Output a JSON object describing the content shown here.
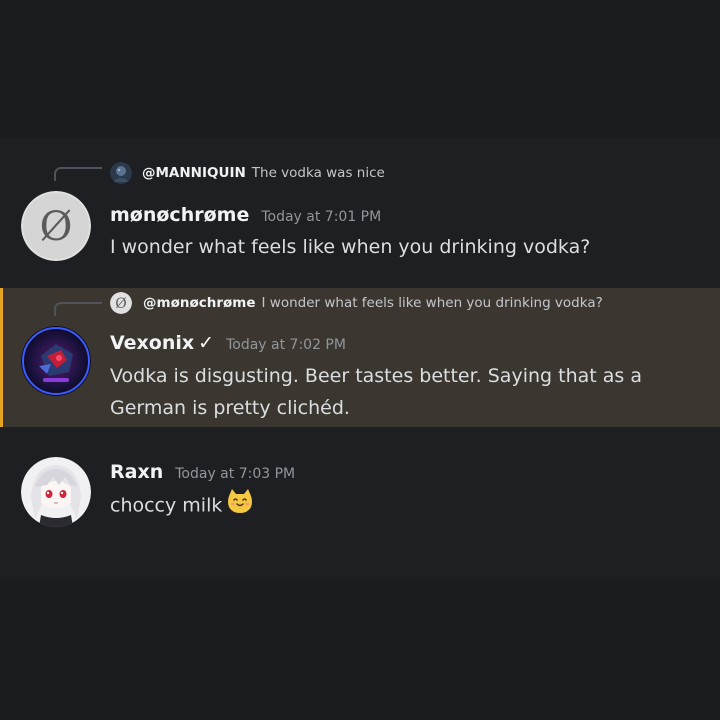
{
  "messages": [
    {
      "reply": {
        "name": "@MANNIQUIN",
        "text": "The vodka was nice",
        "avatar_icon": "manniquin-avatar"
      },
      "author": "mønøchrøme",
      "timestamp": "Today at 7:01 PM",
      "content": "I wonder what feels like when you drinking vodka?",
      "avatar_icon": "null-symbol-avatar",
      "avatar_glyph": "Ø"
    },
    {
      "reply": {
        "name": "@mønøchrøme",
        "text": "I wonder what feels like when you drinking vodka?",
        "avatar_icon": "null-symbol-avatar"
      },
      "author": "Vexonix",
      "verified_mark": "✓",
      "timestamp": "Today at 7:02 PM",
      "content": "Vodka is disgusting. Beer tastes better. Saying that as a German is pretty clichéd.",
      "avatar_icon": "robot-avatar",
      "highlighted": true,
      "highlight_color": "#e5a523"
    },
    {
      "author": "Raxn",
      "timestamp": "Today at 7:03 PM",
      "content": "choccy milk",
      "avatar_icon": "anime-girl-avatar",
      "emoji_icon": "cat-emoji"
    }
  ],
  "colors": {
    "background": "#1b1c20",
    "chat_background": "#1e1f23",
    "highlight_background": "#3b3730",
    "highlight_border": "#e5a523",
    "username": "#f2f3f5",
    "timestamp": "#92959c",
    "text": "#dbdee1"
  }
}
